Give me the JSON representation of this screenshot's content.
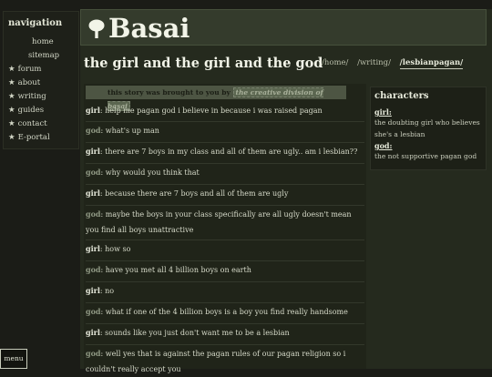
{
  "nav": {
    "title": "navigation",
    "subitems": [
      "home",
      "sitemap"
    ],
    "items": [
      "forum",
      "about",
      "writing",
      "guides",
      "contact",
      "E-portal"
    ]
  },
  "menu_label": "menu",
  "site": {
    "title": "Basai"
  },
  "page": {
    "title": "the girl and the girl and the god",
    "breadcrumbs": [
      "/home/",
      "/writing/",
      "/lesbianpagan/"
    ]
  },
  "credit": {
    "text": "this story was brought to you by ",
    "link": "the creative division of basai"
  },
  "dialogue": [
    {
      "speaker": "girl",
      "text": "help me pagan god i believe in because i was raised pagan"
    },
    {
      "speaker": "god",
      "text": "what's up man"
    },
    {
      "speaker": "girl",
      "text": "there are 7 boys in my class and all of them are ugly.. am i lesbian??"
    },
    {
      "speaker": "god",
      "text": "why would you think that"
    },
    {
      "speaker": "girl",
      "text": "because there are 7 boys and all of them are ugly"
    },
    {
      "speaker": "god",
      "text": "maybe the boys in your class specifically are all ugly doesn't mean",
      "cont": "you find all boys unattractive"
    },
    {
      "speaker": "girl",
      "text": "how so"
    },
    {
      "speaker": "god",
      "text": "have you met all 4 billion boys on earth"
    },
    {
      "speaker": "girl",
      "text": "no"
    },
    {
      "speaker": "god",
      "text": "what if one of the 4 billion boys is a boy you find really handsome"
    },
    {
      "speaker": "girl",
      "text": "sounds like you just don't want me to be a lesbian"
    },
    {
      "speaker": "god",
      "text": "well yes that is against the pagan rules of our pagan religion so i",
      "cont": "couldn't really accept you"
    }
  ],
  "characters": {
    "heading": "characters",
    "list": [
      {
        "name": "girl:",
        "desc": "the doubting girl who believes she's a lesbian"
      },
      {
        "name": "god:",
        "desc": "the not supportive pagan god"
      }
    ]
  }
}
